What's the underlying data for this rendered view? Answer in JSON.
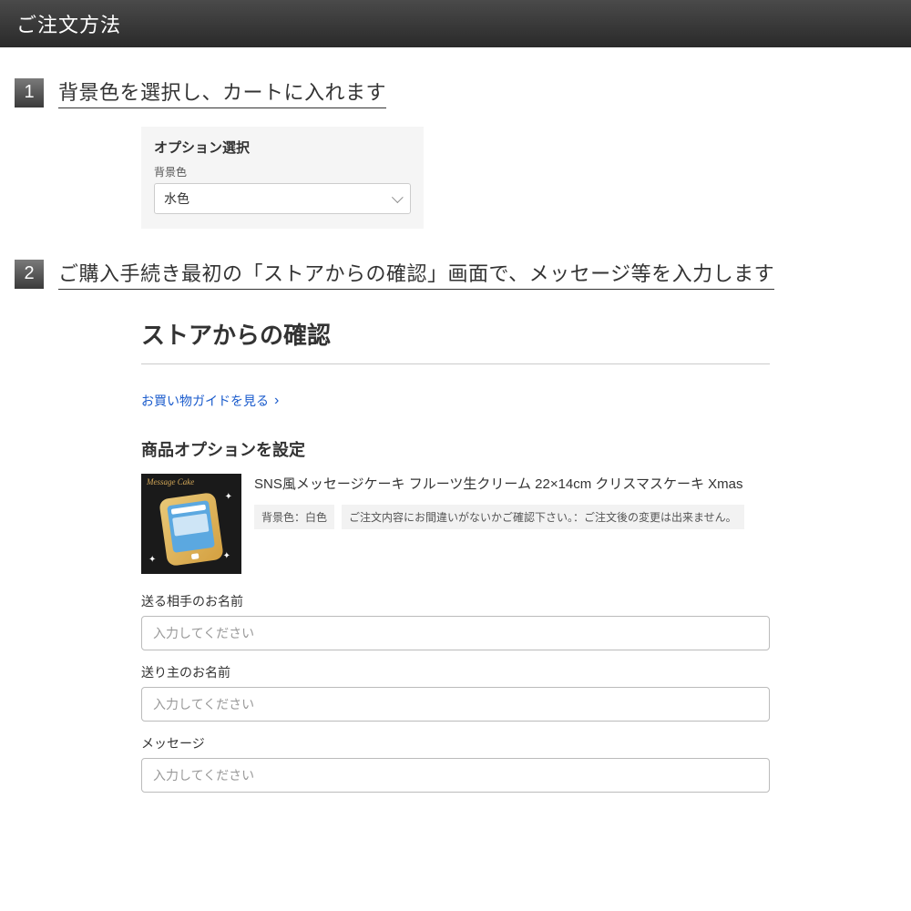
{
  "header": {
    "title": "ご注文方法"
  },
  "steps": [
    {
      "num": "1",
      "text": "背景色を選択し、カートに入れます"
    },
    {
      "num": "2",
      "text": "ご購入手続き最初の「ストアからの確認」画面で、メッセージ等を入力します"
    }
  ],
  "option_box": {
    "title": "オプション選択",
    "label": "背景色",
    "value": "水色"
  },
  "confirm": {
    "title": "ストアからの確認",
    "guide_link": "お買い物ガイドを見る",
    "option_heading": "商品オプションを設定",
    "product": {
      "thumb_label": "Message Cake",
      "name": "SNS風メッセージケーキ フルーツ生クリーム 22×14cm クリスマスケーキ Xmas",
      "tag1": "背景色：白色",
      "tag2": "ご注文内容にお間違いがないかご確認下さい。：ご注文後の変更は出来ません。"
    },
    "fields": [
      {
        "label": "送る相手のお名前",
        "placeholder": "入力してください"
      },
      {
        "label": "送り主のお名前",
        "placeholder": "入力してください"
      },
      {
        "label": "メッセージ",
        "placeholder": "入力してください"
      }
    ]
  }
}
